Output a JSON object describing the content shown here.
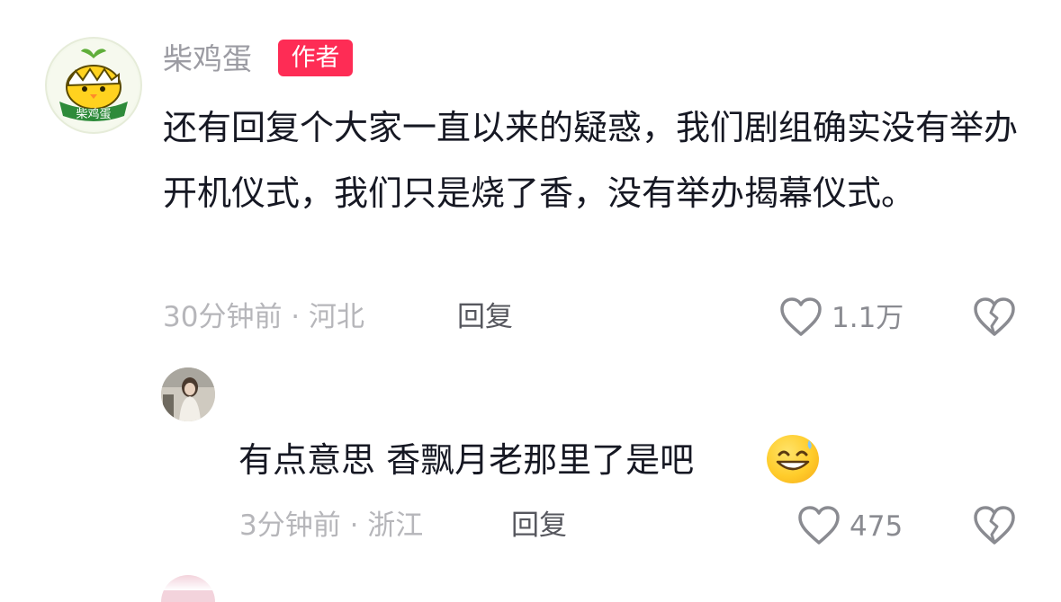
{
  "comment": {
    "username": "柴鸡蛋",
    "author_badge": "作者",
    "avatar_text": "柴鸡蛋",
    "text": "还有回复个大家一直以来的疑惑，我们剧组确实没有举办开机仪式，我们只是烧了香，没有举办揭幕仪式。",
    "time_location": "30分钟前 · 河北",
    "reply_label": "回复",
    "like_count": "1.1万"
  },
  "reply": {
    "username": "",
    "text": "有点意思 香飘月老那里了是吧",
    "emoji": "grinning-sweat",
    "time_location": "3分钟前 · 浙江",
    "reply_label": "回复",
    "like_count": "475"
  },
  "colors": {
    "author_badge": "#fe2c55",
    "text": "#161823",
    "meta": "#b6b6ba"
  },
  "icons": [
    "heart-outline-icon",
    "broken-heart-icon"
  ]
}
